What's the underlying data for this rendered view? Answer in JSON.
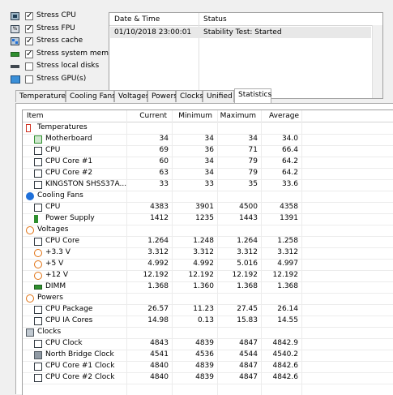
{
  "stress_options": [
    {
      "label": "Stress CPU",
      "checked": true,
      "icon": "cpu-chip-icon"
    },
    {
      "label": "Stress FPU",
      "checked": true,
      "icon": "fpu-icon"
    },
    {
      "label": "Stress cache",
      "checked": true,
      "icon": "cache-icon"
    },
    {
      "label": "Stress system memory",
      "checked": true,
      "icon": "memory-icon"
    },
    {
      "label": "Stress local disks",
      "checked": false,
      "icon": "disk-icon"
    },
    {
      "label": "Stress GPU(s)",
      "checked": false,
      "icon": "gpu-icon"
    }
  ],
  "log": {
    "headers": {
      "date": "Date & Time",
      "status": "Status"
    },
    "rows": [
      {
        "date": "01/10/2018 23:00:01",
        "status": "Stability Test: Started"
      }
    ]
  },
  "tabs": [
    "Temperatures",
    "Cooling Fans",
    "Voltages",
    "Powers",
    "Clocks",
    "Unified",
    "Statistics"
  ],
  "active_tab": "Statistics",
  "stats": {
    "headers": {
      "item": "Item",
      "current": "Current",
      "minimum": "Minimum",
      "maximum": "Maximum",
      "average": "Average"
    },
    "rows": [
      {
        "kind": "group",
        "name": "Temperatures",
        "icon": "thermometer-icon"
      },
      {
        "kind": "item",
        "name": "Motherboard",
        "icon": "motherboard-icon",
        "current": "34",
        "minimum": "34",
        "maximum": "34",
        "average": "34.0"
      },
      {
        "kind": "item",
        "name": "CPU",
        "icon": "cpu-icon",
        "current": "69",
        "minimum": "36",
        "maximum": "71",
        "average": "66.4"
      },
      {
        "kind": "item",
        "name": "CPU Core #1",
        "icon": "cpu-core-icon",
        "current": "60",
        "minimum": "34",
        "maximum": "79",
        "average": "64.2"
      },
      {
        "kind": "item",
        "name": "CPU Core #2",
        "icon": "cpu-core-icon",
        "current": "63",
        "minimum": "34",
        "maximum": "79",
        "average": "64.2"
      },
      {
        "kind": "item",
        "name": "KINGSTON SHSS37A...",
        "icon": "drive-icon",
        "current": "33",
        "minimum": "33",
        "maximum": "35",
        "average": "33.6"
      },
      {
        "kind": "group",
        "name": "Cooling Fans",
        "icon": "fan-icon"
      },
      {
        "kind": "item",
        "name": "CPU",
        "icon": "cpu-icon",
        "current": "4383",
        "minimum": "3901",
        "maximum": "4500",
        "average": "4358"
      },
      {
        "kind": "item",
        "name": "Power Supply",
        "icon": "power-supply-icon",
        "current": "1412",
        "minimum": "1235",
        "maximum": "1443",
        "average": "1391"
      },
      {
        "kind": "group",
        "name": "Voltages",
        "icon": "voltage-icon"
      },
      {
        "kind": "item",
        "name": "CPU Core",
        "icon": "cpu-icon",
        "current": "1.264",
        "minimum": "1.248",
        "maximum": "1.264",
        "average": "1.258"
      },
      {
        "kind": "item",
        "name": "+3.3 V",
        "icon": "voltage-icon",
        "current": "3.312",
        "minimum": "3.312",
        "maximum": "3.312",
        "average": "3.312"
      },
      {
        "kind": "item",
        "name": "+5 V",
        "icon": "voltage-icon",
        "current": "4.992",
        "minimum": "4.992",
        "maximum": "5.016",
        "average": "4.997"
      },
      {
        "kind": "item",
        "name": "+12 V",
        "icon": "voltage-icon",
        "current": "12.192",
        "minimum": "12.192",
        "maximum": "12.192",
        "average": "12.192"
      },
      {
        "kind": "item",
        "name": "DIMM",
        "icon": "memory-icon",
        "current": "1.368",
        "minimum": "1.360",
        "maximum": "1.368",
        "average": "1.368"
      },
      {
        "kind": "group",
        "name": "Powers",
        "icon": "power-icon"
      },
      {
        "kind": "item",
        "name": "CPU Package",
        "icon": "cpu-icon",
        "current": "26.57",
        "minimum": "11.23",
        "maximum": "27.45",
        "average": "26.14"
      },
      {
        "kind": "item",
        "name": "CPU IA Cores",
        "icon": "cpu-icon",
        "current": "14.98",
        "minimum": "0.13",
        "maximum": "15.83",
        "average": "14.55"
      },
      {
        "kind": "group",
        "name": "Clocks",
        "icon": "clock-icon"
      },
      {
        "kind": "item",
        "name": "CPU Clock",
        "icon": "cpu-icon",
        "current": "4843",
        "minimum": "4839",
        "maximum": "4847",
        "average": "4842.9"
      },
      {
        "kind": "item",
        "name": "North Bridge Clock",
        "icon": "north-bridge-icon",
        "current": "4541",
        "minimum": "4536",
        "maximum": "4544",
        "average": "4540.2"
      },
      {
        "kind": "item",
        "name": "CPU Core #1 Clock",
        "icon": "cpu-core-icon",
        "current": "4840",
        "minimum": "4839",
        "maximum": "4847",
        "average": "4842.6"
      },
      {
        "kind": "item",
        "name": "CPU Core #2 Clock",
        "icon": "cpu-core-icon",
        "current": "4840",
        "minimum": "4839",
        "maximum": "4847",
        "average": "4842.6"
      }
    ]
  },
  "colors": {
    "accent_blue": "#1e6fd9",
    "thermo_red": "#d03020",
    "volt_orange": "#e07010",
    "green": "#2f8f2f"
  }
}
